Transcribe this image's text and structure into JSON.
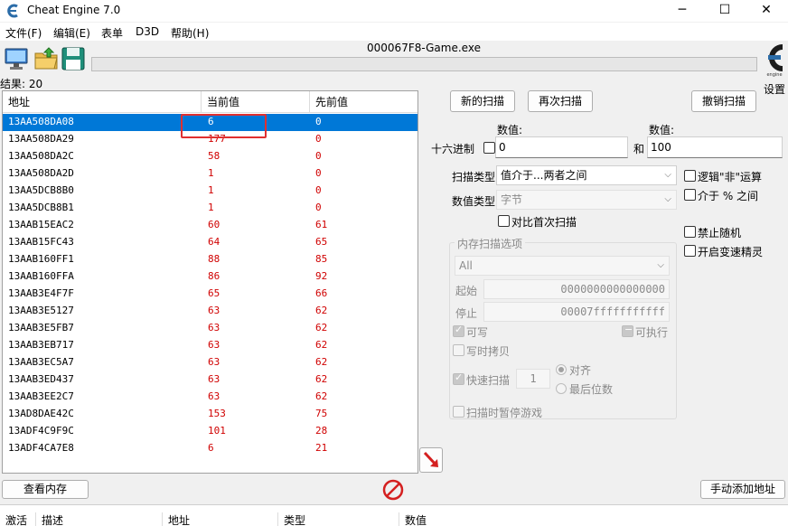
{
  "window": {
    "title": "Cheat Engine 7.0",
    "minimize": "─",
    "maximize": "☐",
    "close": "✕"
  },
  "menu": [
    "文件(F)",
    "编辑(E)",
    "表单",
    "D3D",
    "帮助(H)"
  ],
  "process": "000067F8-Game.exe",
  "settings_label": "设置",
  "results_label": "结果: 20",
  "columns": {
    "address": "地址",
    "current": "当前值",
    "previous": "先前值"
  },
  "rows": [
    {
      "address": "13AA508DA08",
      "current": "6",
      "previous": "0"
    },
    {
      "address": "13AA508DA29",
      "current": "177",
      "previous": "0"
    },
    {
      "address": "13AA508DA2C",
      "current": "58",
      "previous": "0"
    },
    {
      "address": "13AA508DA2D",
      "current": "1",
      "previous": "0"
    },
    {
      "address": "13AA5DCB8B0",
      "current": "1",
      "previous": "0"
    },
    {
      "address": "13AA5DCB8B1",
      "current": "1",
      "previous": "0"
    },
    {
      "address": "13AAB15EAC2",
      "current": "60",
      "previous": "61"
    },
    {
      "address": "13AAB15FC43",
      "current": "64",
      "previous": "65"
    },
    {
      "address": "13AAB160FF1",
      "current": "88",
      "previous": "85"
    },
    {
      "address": "13AAB160FFA",
      "current": "86",
      "previous": "92"
    },
    {
      "address": "13AAB3E4F7F",
      "current": "65",
      "previous": "66"
    },
    {
      "address": "13AAB3E5127",
      "current": "63",
      "previous": "62"
    },
    {
      "address": "13AAB3E5FB7",
      "current": "63",
      "previous": "62"
    },
    {
      "address": "13AAB3EB717",
      "current": "63",
      "previous": "62"
    },
    {
      "address": "13AAB3EC5A7",
      "current": "63",
      "previous": "62"
    },
    {
      "address": "13AAB3ED437",
      "current": "63",
      "previous": "62"
    },
    {
      "address": "13AAB3EE2C7",
      "current": "63",
      "previous": "62"
    },
    {
      "address": "13AD8DAE42C",
      "current": "153",
      "previous": "75"
    },
    {
      "address": "13ADF4C9F9C",
      "current": "101",
      "previous": "28"
    },
    {
      "address": "13ADF4CA7E8",
      "current": "6",
      "previous": "21"
    }
  ],
  "selected_row": 0,
  "scan": {
    "new_scan": "新的扫描",
    "next_scan": "再次扫描",
    "undo_scan": "撤销扫描",
    "value_label_1": "数值:",
    "value_label_2": "数值:",
    "hex_label": "十六进制",
    "value_1": "0",
    "and_label": "和",
    "value_2": "100",
    "scan_type_label": "扫描类型",
    "scan_type": "值介于...两者之间",
    "value_type_label": "数值类型",
    "value_type": "字节",
    "compare_first": "对比首次扫描",
    "logic_not": "逻辑\"非\"运算",
    "percent_between": "介于 % 之间",
    "disable_random": "禁止随机",
    "speedhack": "开启变速精灵"
  },
  "memory_options": {
    "title": "内存扫描选项",
    "region": "All",
    "start_label": "起始",
    "start_value": "0000000000000000",
    "stop_label": "停止",
    "stop_value": "00007fffffffffff",
    "writable": "可写",
    "executable": "可执行",
    "copy_on_write": "写时拷贝",
    "fast_scan": "快速扫描",
    "fast_scan_value": "1",
    "align": "对齐",
    "last_digits": "最后位数",
    "pause_game": "扫描时暂停游戏"
  },
  "bottom": {
    "view_memory": "查看内存",
    "add_address": "手动添加地址",
    "col_active": "激活",
    "col_desc": "描述",
    "col_address": "地址",
    "col_type": "类型",
    "col_value": "数值"
  },
  "icons": {
    "app": "cheat-engine-icon",
    "open_process": "computer-icon",
    "open_file": "folder-open-icon",
    "save": "floppy-disk-icon",
    "logo": "cheat-engine-logo",
    "arrow": "red-arrow-icon",
    "stop": "no-entry-icon"
  },
  "colors": {
    "accent": "#0078d7",
    "value_red": "#d00000",
    "annotation_red": "#e03030"
  }
}
